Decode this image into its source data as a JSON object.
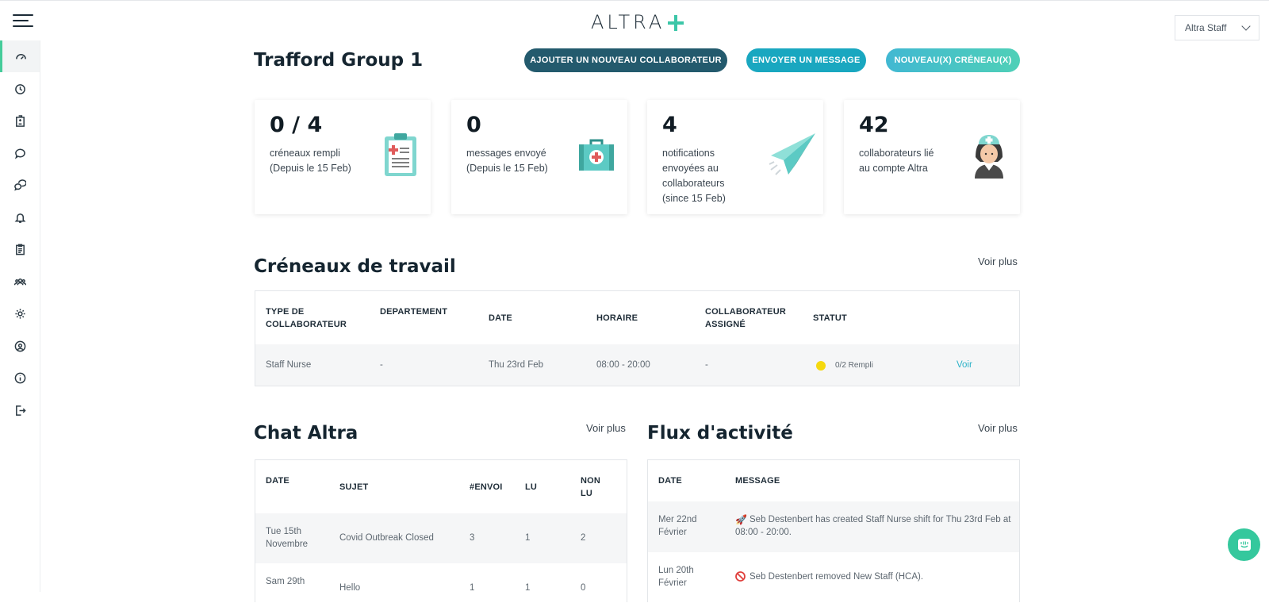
{
  "header": {
    "logo_text": "ALTRA",
    "account_select": "Altra Staff"
  },
  "sidebar": {
    "items": [
      {
        "name": "dashboard",
        "icon": "gauge-icon",
        "active": true
      },
      {
        "name": "history",
        "icon": "clock-icon"
      },
      {
        "name": "hospital",
        "icon": "building-icon"
      },
      {
        "name": "chat",
        "icon": "chat-bubble-icon"
      },
      {
        "name": "conversations",
        "icon": "chat-bubbles-icon"
      },
      {
        "name": "notifications",
        "icon": "bell-icon"
      },
      {
        "name": "shifts",
        "icon": "clipboard-icon"
      },
      {
        "name": "staff",
        "icon": "people-icon"
      },
      {
        "name": "settings",
        "icon": "gear-icon"
      },
      {
        "name": "profile",
        "icon": "user-circle-icon"
      },
      {
        "name": "info",
        "icon": "info-icon"
      },
      {
        "name": "logout",
        "icon": "logout-icon"
      }
    ]
  },
  "page": {
    "title": "Trafford Group 1",
    "buttons": {
      "add_staff": "Ajouter un nouveau collaborateur",
      "send_message": "Envoyer un message",
      "new_shifts": "Nouveau(x) créneau(x)"
    }
  },
  "stats": [
    {
      "value": "0 / 4",
      "desc": "créneaux rempli\n(Depuis le 15 Feb)",
      "icon": "clipboard-medical-icon"
    },
    {
      "value": "0",
      "desc": "messages envoyé\n(Depuis le 15 Feb)",
      "icon": "medical-kit-icon"
    },
    {
      "value": "4",
      "desc": "notifications\nenvoyées au\ncollaborateurs\n(since 15 Feb)",
      "icon": "paper-plane-icon"
    },
    {
      "value": "42",
      "desc": "collaborateurs lié\nau compte Altra",
      "icon": "nurse-icon"
    }
  ],
  "shifts": {
    "title": "Créneaux de travail",
    "see_more": "Voir plus",
    "headers": [
      "Type de collaborateur",
      "Departement",
      "Date",
      "Horaire",
      "Collaborateur assigné",
      "Statut"
    ],
    "rows": [
      {
        "type": "Staff Nurse",
        "department": "-",
        "date": "Thu 23rd Feb",
        "time": "08:00 - 20:00",
        "assigned": "-",
        "status": "0/2 Rempli",
        "action": "Voir"
      }
    ]
  },
  "chat": {
    "title": "Chat Altra",
    "see_more": "Voir plus",
    "headers": [
      "Date",
      "Sujet",
      "#Envoi",
      "Lu",
      "Non lu"
    ],
    "rows": [
      {
        "date": "Tue 15th Novembre",
        "subject": "Covid Outbreak Closed",
        "sent": "3",
        "read": "1",
        "unread": "2"
      },
      {
        "date": "Sam 29th",
        "subject": "Hello",
        "sent": "1",
        "read": "1",
        "unread": "0"
      }
    ]
  },
  "activity": {
    "title": "Flux d'activité",
    "see_more": "Voir plus",
    "headers": [
      "Date",
      "Message"
    ],
    "rows": [
      {
        "date": "Mer 22nd Février",
        "message": "Seb Destenbert has created Staff Nurse shift for Thu 23rd Feb at 08:00 - 20:00.",
        "icon": "rocket-icon"
      },
      {
        "date": "Lun 20th Février",
        "message": "Seb Destenbert removed New Staff (HCA).",
        "icon": "prohibited-icon"
      }
    ]
  },
  "colors": {
    "accent_green": "#45cc9a",
    "dark_teal": "#235a6d",
    "teal": "#19a7c0",
    "status_yellow": "#f5d90f"
  }
}
